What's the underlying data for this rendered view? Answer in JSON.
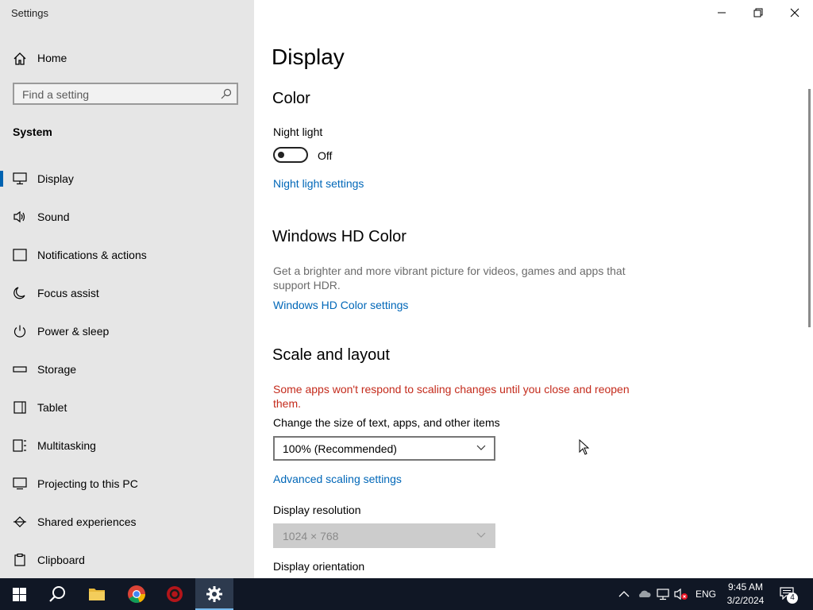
{
  "window": {
    "title": "Settings"
  },
  "sidebar": {
    "home_label": "Home",
    "search_placeholder": "Find a setting",
    "section_label": "System",
    "items": [
      {
        "label": "Display",
        "icon": "monitor-icon",
        "active": true
      },
      {
        "label": "Sound",
        "icon": "speaker-icon"
      },
      {
        "label": "Notifications & actions",
        "icon": "notification-icon"
      },
      {
        "label": "Focus assist",
        "icon": "moon-icon"
      },
      {
        "label": "Power & sleep",
        "icon": "power-icon"
      },
      {
        "label": "Storage",
        "icon": "storage-icon"
      },
      {
        "label": "Tablet",
        "icon": "tablet-icon"
      },
      {
        "label": "Multitasking",
        "icon": "multitasking-icon"
      },
      {
        "label": "Projecting to this PC",
        "icon": "projecting-icon"
      },
      {
        "label": "Shared experiences",
        "icon": "shared-experiences-icon"
      },
      {
        "label": "Clipboard",
        "icon": "clipboard-icon"
      }
    ]
  },
  "main": {
    "title": "Display",
    "color": {
      "heading": "Color",
      "night_light_label": "Night light",
      "night_light_state": "Off",
      "night_light_link": "Night light settings"
    },
    "hd_color": {
      "heading": "Windows HD Color",
      "description": "Get a brighter and more vibrant picture for videos, games and apps that support HDR.",
      "link": "Windows HD Color settings"
    },
    "scale": {
      "heading": "Scale and layout",
      "warning": "Some apps won't respond to scaling changes until you close and reopen them.",
      "size_label": "Change the size of text, apps, and other items",
      "size_value": "100% (Recommended)",
      "advanced_link": "Advanced scaling settings",
      "resolution_label": "Display resolution",
      "resolution_value": "1024 × 768",
      "orientation_label": "Display orientation"
    }
  },
  "taskbar": {
    "language": "ENG",
    "time": "9:45 AM",
    "date": "3/2/2024",
    "notification_count": "4"
  },
  "colors": {
    "accent": "#0067b8",
    "warning": "#c42b1c",
    "sidebar_bg": "#e6e6e6",
    "taskbar_bg": "#101725"
  }
}
